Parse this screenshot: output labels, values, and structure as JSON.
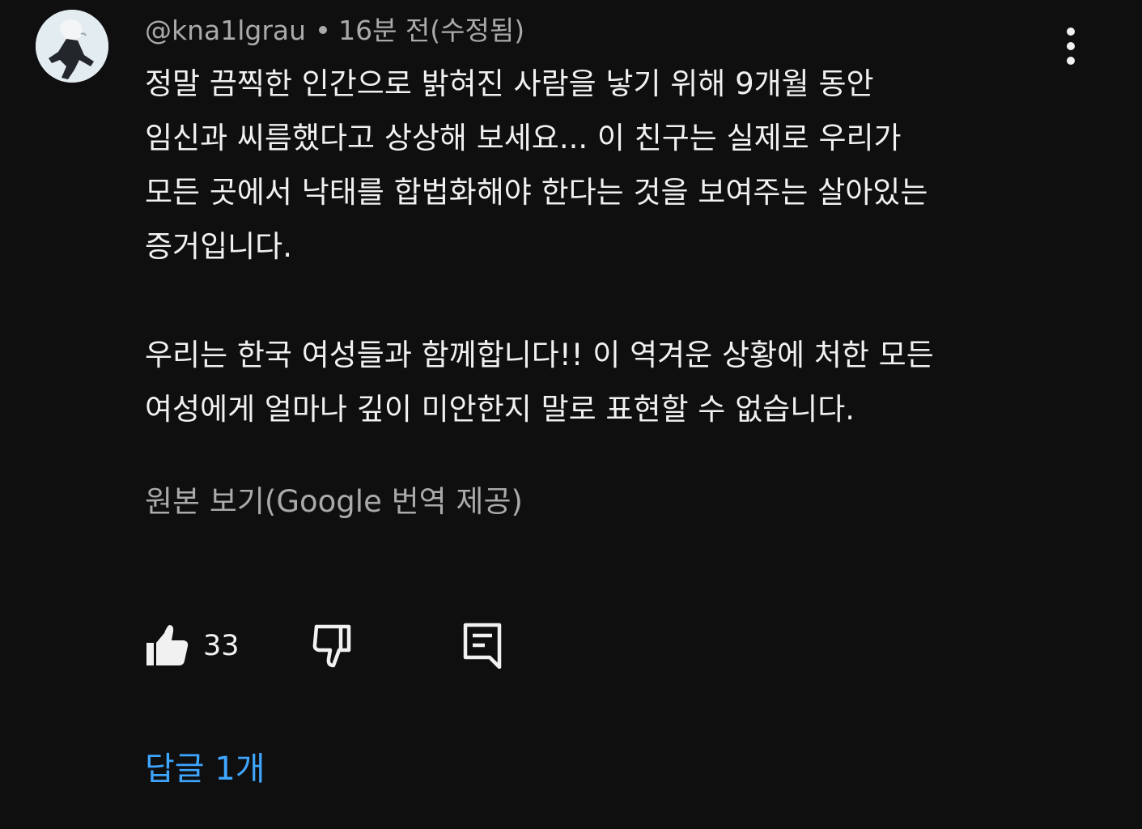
{
  "comment": {
    "author": "@kna1lgrau",
    "time": "16분 전(수정됨)",
    "lines": [
      "정말 끔찍한 인간으로 밝혀진 사람을 낳기 위해 9개월 동안",
      "임신과 씨름했다고 상상해 보세요... 이 친구는 실제로 우리가",
      "모든 곳에서 낙태를 합법화해야 한다는 것을 보여주는 살아있는",
      "증거입니다.",
      "",
      "우리는 한국 여성들과 함께합니다!! 이 역겨운 상황에 처한 모든",
      "여성에게 얼마나 깊이 미안한지 말로 표현할 수 없습니다."
    ],
    "show_original": "원본 보기(Google 번역 제공)",
    "like_count": "33",
    "replies_label": "답글 1개"
  },
  "icons": {
    "avatar": "avatar-image",
    "more": "more-vertical-icon",
    "like": "thumbs-up-icon",
    "dislike": "thumbs-down-icon",
    "reply": "reply-comment-icon"
  },
  "colors": {
    "background": "#0f0f0f",
    "text_primary": "#f1f1f1",
    "text_secondary": "#aaaaaa",
    "link": "#3ea6ff"
  }
}
